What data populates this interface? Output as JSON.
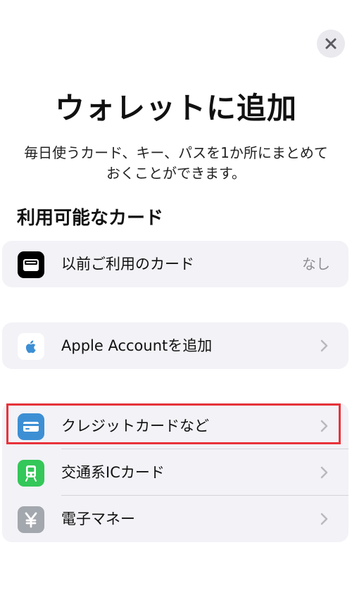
{
  "header": {
    "title": "ウォレットに追加",
    "subtitle_line1": "毎日使うカード、キー、パスを1か所にまとめて",
    "subtitle_line2": "おくことができます。"
  },
  "section": {
    "heading": "利用可能なカード"
  },
  "groups": [
    {
      "rows": [
        {
          "label": "以前ご利用のカード",
          "value": "なし",
          "icon": "wallet-icon",
          "icon_color": "#000000"
        }
      ]
    },
    {
      "rows": [
        {
          "label": "Apple Accountを追加",
          "icon": "apple-logo-icon",
          "icon_color": "#ffffff"
        }
      ]
    },
    {
      "rows": [
        {
          "label": "クレジットカードなど",
          "icon": "credit-card-icon",
          "icon_color": "#3d8fd4",
          "highlighted": true
        },
        {
          "label": "交通系ICカード",
          "icon": "train-icon",
          "icon_color": "#34c759"
        },
        {
          "label": "電子マネー",
          "icon": "yen-icon",
          "icon_color": "#a3a7ae"
        }
      ]
    }
  ],
  "colors": {
    "background": "#ffffff",
    "group_background": "#f2f2f7",
    "highlight_border": "#e8333a",
    "secondary_text": "#8e8e93"
  },
  "close_icon": "close-icon"
}
